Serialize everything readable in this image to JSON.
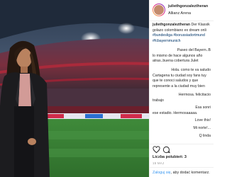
{
  "post": {
    "username": "juliethgonzaleztheran",
    "location": "Allianz Arena"
  },
  "comments": {
    "caption": [
      {
        "user": "juliethgonzaleztheran",
        "text": " Der Klassik"
      },
      {
        "text": "golazo colombiano ex dream onli"
      },
      {
        "text": "#bundesliga #borussiadortmund"
      },
      {
        "text": "#fcbayernmunich"
      }
    ],
    "c1": [
      "Paseo del Bayern..B",
      "lo mismo de hace algunos año",
      "atras..buena cobertura Julet"
    ],
    "c2": [
      "Hola. como te va saludo",
      "Cartagena tu ciudad soy fans tuy",
      "que te conoci saludos y que",
      "represente a la ciudad muy bien"
    ],
    "c3": [
      "Hermosa. felicitacio",
      "trabajo"
    ],
    "c4": [
      "Esa sonri",
      "ese estadio. Hermosaaaaa."
    ],
    "c5": [
      "Love this!"
    ],
    "c6": [
      "Mi norte!..."
    ],
    "c7": [
      "Q linda"
    ]
  },
  "likes_label": "Liczba polubień: 3",
  "date_label": "15 MAJ",
  "login": {
    "link": "Zaloguj się",
    "rest": ", aby dodać komentarz."
  }
}
